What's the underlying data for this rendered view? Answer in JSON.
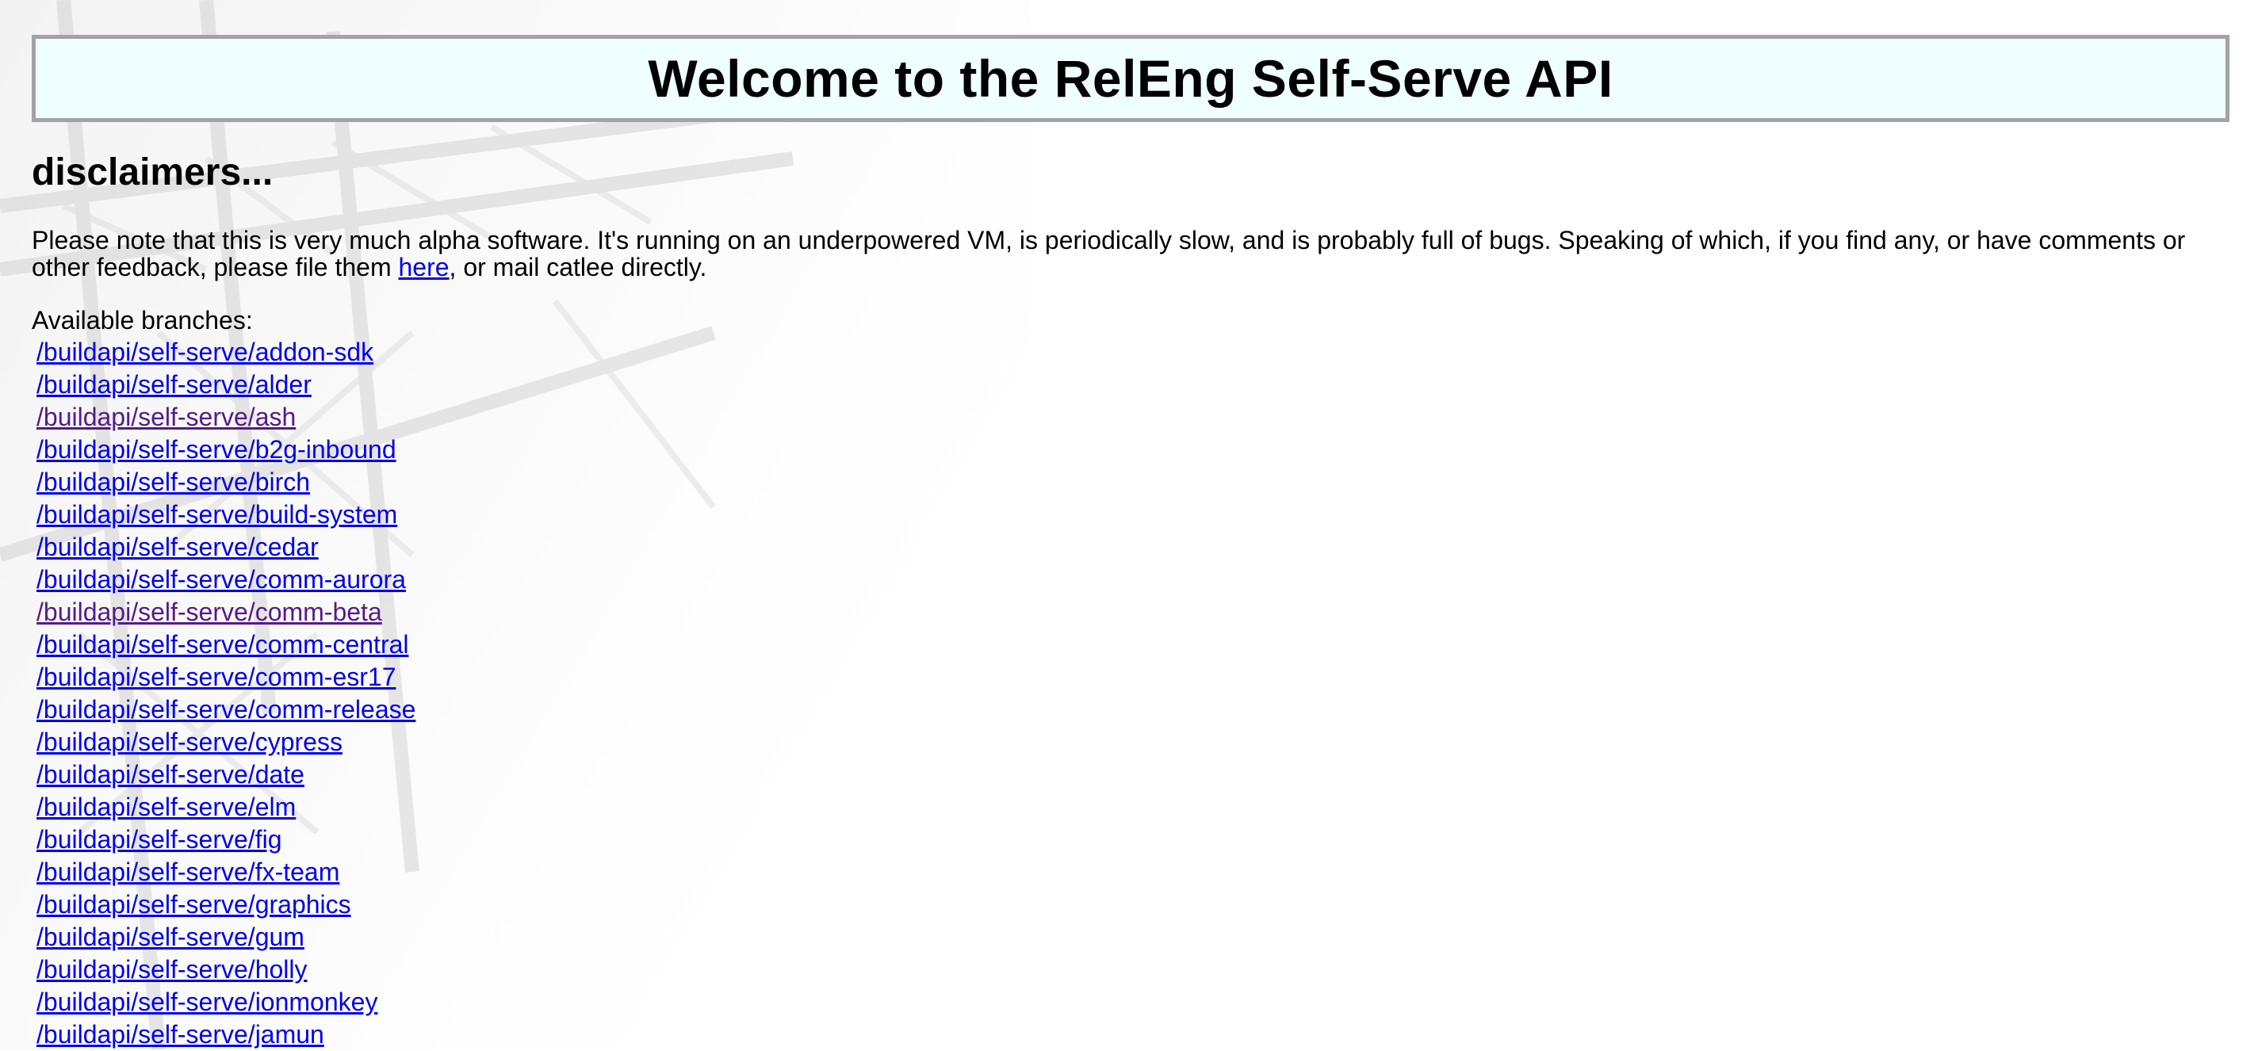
{
  "header": {
    "title": "Welcome to the RelEng Self-Serve API"
  },
  "disclaimers": {
    "heading": "disclaimers...",
    "text_before_link": "Please note that this is very much alpha software. It's running on an underpowered VM, is periodically slow, and is probably full of bugs. Speaking of which, if you find any, or have comments or other feedback, please file them ",
    "link_label": "here",
    "text_after_link": ", or mail catlee directly."
  },
  "branches": {
    "label": "Available branches:",
    "items": [
      {
        "label": "/buildapi/self-serve/addon-sdk",
        "visited": false
      },
      {
        "label": "/buildapi/self-serve/alder",
        "visited": false
      },
      {
        "label": "/buildapi/self-serve/ash",
        "visited": true
      },
      {
        "label": "/buildapi/self-serve/b2g-inbound",
        "visited": false
      },
      {
        "label": "/buildapi/self-serve/birch",
        "visited": false
      },
      {
        "label": "/buildapi/self-serve/build-system",
        "visited": false
      },
      {
        "label": "/buildapi/self-serve/cedar",
        "visited": false
      },
      {
        "label": "/buildapi/self-serve/comm-aurora",
        "visited": false
      },
      {
        "label": "/buildapi/self-serve/comm-beta",
        "visited": true
      },
      {
        "label": "/buildapi/self-serve/comm-central",
        "visited": false
      },
      {
        "label": "/buildapi/self-serve/comm-esr17",
        "visited": false
      },
      {
        "label": "/buildapi/self-serve/comm-release",
        "visited": false
      },
      {
        "label": "/buildapi/self-serve/cypress",
        "visited": false
      },
      {
        "label": "/buildapi/self-serve/date",
        "visited": false
      },
      {
        "label": "/buildapi/self-serve/elm",
        "visited": false
      },
      {
        "label": "/buildapi/self-serve/fig",
        "visited": false
      },
      {
        "label": "/buildapi/self-serve/fx-team",
        "visited": false
      },
      {
        "label": "/buildapi/self-serve/graphics",
        "visited": false
      },
      {
        "label": "/buildapi/self-serve/gum",
        "visited": false
      },
      {
        "label": "/buildapi/self-serve/holly",
        "visited": false
      },
      {
        "label": "/buildapi/self-serve/ionmonkey",
        "visited": false
      },
      {
        "label": "/buildapi/self-serve/jamun",
        "visited": false
      }
    ]
  },
  "colors": {
    "link": "#0000ee",
    "visited_link": "#551a8b",
    "title_background": "#efffff",
    "title_border": "#a3a3a3"
  },
  "background_image": "faded-industrial-crane-structure"
}
